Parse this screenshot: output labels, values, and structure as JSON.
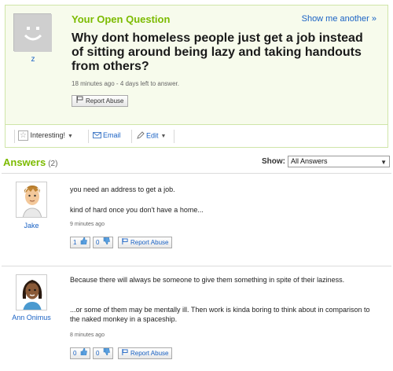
{
  "question": {
    "heading": "Your Open Question",
    "show_another": "Show me another »",
    "user": "z",
    "title": "Why dont homeless people just get a job instead of sitting around being lazy and taking handouts from others?",
    "meta": "18 minutes ago - 4 days left to answer.",
    "report_abuse": "Report Abuse"
  },
  "toolbar": {
    "interesting": "Interesting!",
    "email": "Email",
    "edit": "Edit"
  },
  "answers": {
    "heading": "Answers",
    "count": "(2)",
    "show_label": "Show:",
    "show_value": "All Answers",
    "items": [
      {
        "user": "Jake",
        "paragraphs": [
          "you need an address to get a job.",
          "kind of hard once you don't have a home..."
        ],
        "meta": "9 minutes ago",
        "up": "1",
        "down": "0",
        "report": "Report Abuse"
      },
      {
        "user": "Ann Onimus",
        "paragraphs": [
          "Because there will always be someone to give them something in spite of their laziness.",
          "...or some of them may be mentally ill. Then work is kinda boring to think about in comparison to the naked monkey in a spaceship."
        ],
        "meta": "8 minutes ago",
        "up": "0",
        "down": "0",
        "report": "Report Abuse"
      }
    ]
  },
  "colors": {
    "accent_green": "#7cbb00",
    "link_blue": "#1a62c4"
  }
}
